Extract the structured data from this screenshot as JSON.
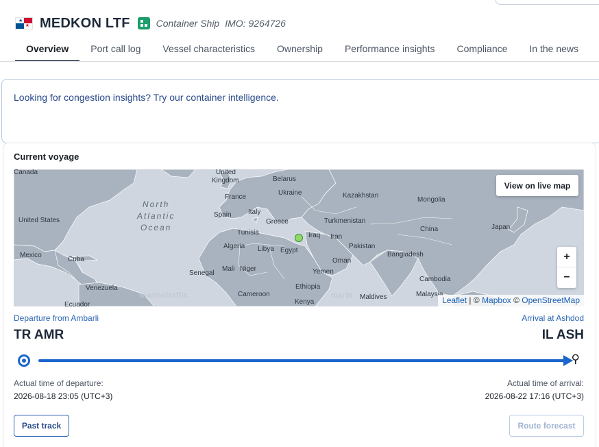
{
  "header": {
    "vessel_name": "MEDKON LTF",
    "vessel_type": "Container Ship",
    "imo": "IMO: 9264726",
    "flag_icon": "panama-flag-icon"
  },
  "tabs": [
    {
      "label": "Overview",
      "active": true
    },
    {
      "label": "Port call log"
    },
    {
      "label": "Vessel characteristics"
    },
    {
      "label": "Ownership"
    },
    {
      "label": "Performance insights"
    },
    {
      "label": "Compliance"
    },
    {
      "label": "In the news"
    }
  ],
  "banner": {
    "text": "Looking for congestion insights? Try our container intelligence."
  },
  "voyage": {
    "title": "Current voyage",
    "map": {
      "view_live_label": "View on live map",
      "zoom_in": "+",
      "zoom_out": "−",
      "ocean_label": [
        "North",
        "Atlantic",
        "Ocean"
      ],
      "watermark": "marinetraffic",
      "watermark2": "marin",
      "attribution": {
        "leaflet": "Leaflet",
        "sep1": " | © ",
        "mapbox": "Mapbox",
        "sep2": " © ",
        "osm": "OpenStreetMap"
      },
      "labels": [
        "Canada",
        "United",
        "Kingdom",
        "Belarus",
        "Ukraine",
        "Kazakhstan",
        "Mongolia",
        "France",
        "Spain",
        "Italy",
        "Greece",
        "Turkmenistan",
        "United States",
        "Tunisia",
        "Iraq",
        "Iran",
        "China",
        "Japan",
        "Algeria",
        "Libya",
        "Egypt",
        "Pakistan",
        "Mexico",
        "Cuba",
        "Oman",
        "Bangladesh",
        "Mali",
        "Niger",
        "Senegal",
        "Yemen",
        "Cambodia",
        "Venezuela",
        "Cameroon",
        "Ethiopia",
        "Maldives",
        "Malaysia",
        "Ecuador",
        "Kenya"
      ]
    },
    "departure": {
      "label": "Departure from Ambarli",
      "code": "TR AMR",
      "time_label": "Actual time of departure:",
      "time": "2026-08-18 23:05 (UTC+3)"
    },
    "arrival": {
      "label": "Arrival at Ashdod",
      "code": "IL ASH",
      "time_label": "Actual time of arrival:",
      "time": "2026-08-22 17:16 (UTC+3)"
    },
    "progress_fraction": 1.0,
    "buttons": {
      "past_track": "Past track",
      "route_forecast": "Route forecast"
    }
  },
  "colors": {
    "accent": "#1a66cc",
    "type_badge": "#1a9e6b",
    "vessel_position": "#8fd96b"
  }
}
